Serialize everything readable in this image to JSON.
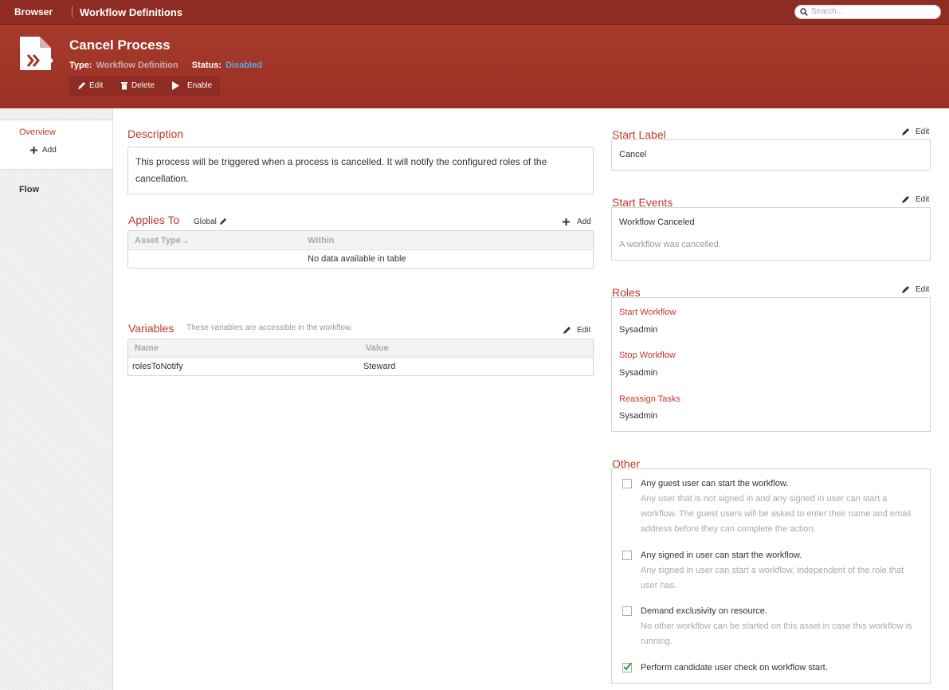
{
  "topbar": {
    "browser": "Browser",
    "breadcrumb": "Workflow Definitions",
    "search_placeholder": "Search..."
  },
  "header": {
    "title": "Cancel Process",
    "type_label": "Type:",
    "type_value": "Workflow Definition",
    "status_label": "Status:",
    "status_value": "Disabled",
    "actions": {
      "edit": "Edit",
      "delete": "Delete",
      "enable": "Enable"
    }
  },
  "sidebar": {
    "overview": "Overview",
    "add": "Add",
    "flow": "Flow"
  },
  "description": {
    "title": "Description",
    "text": "This process will be triggered when a process is cancelled. It will notify the configured roles of the cancellation."
  },
  "applies_to": {
    "title": "Applies To",
    "scope": "Global",
    "add": "Add",
    "columns": [
      "Asset Type",
      "Within"
    ],
    "empty": "No data available in table"
  },
  "variables": {
    "title": "Variables",
    "hint": "These variables are accessible in the workflow.",
    "edit": "Edit",
    "columns": [
      "Name",
      "Value"
    ],
    "rows": [
      {
        "name": "rolesToNotify",
        "value": "Steward"
      }
    ]
  },
  "start_label": {
    "title": "Start Label",
    "edit": "Edit",
    "value": "Cancel"
  },
  "start_events": {
    "title": "Start Events",
    "edit": "Edit",
    "event": "Workflow Canceled",
    "event_desc": "A workflow was cancelled."
  },
  "roles": {
    "title": "Roles",
    "edit": "Edit",
    "items": [
      {
        "label": "Start Workflow",
        "value": "Sysadmin"
      },
      {
        "label": "Stop Workflow",
        "value": "Sysadmin"
      },
      {
        "label": "Reassign Tasks",
        "value": "Sysadmin"
      }
    ]
  },
  "other": {
    "title": "Other",
    "options": [
      {
        "label": "Any guest user can start the workflow.",
        "help": "Any user that is not signed in and any signed in user can start a workflow. The guest users will be asked to enter their name and email address before they can complete the action.",
        "checked": false
      },
      {
        "label": "Any signed in user can start the workflow.",
        "help": "Any signed in user can start a workflow, independent of the role that user has.",
        "checked": false
      },
      {
        "label": "Demand exclusivity on resource.",
        "help": "No other workflow can be started on this asset in case this workflow is running.",
        "checked": false
      },
      {
        "label": "Perform candidate user check on workflow start.",
        "help": "",
        "checked": true
      }
    ]
  },
  "colors": {
    "brand": "#a23528",
    "accent": "#c0392b",
    "status": "#5fa9e0",
    "check": "#3a9a3a"
  }
}
